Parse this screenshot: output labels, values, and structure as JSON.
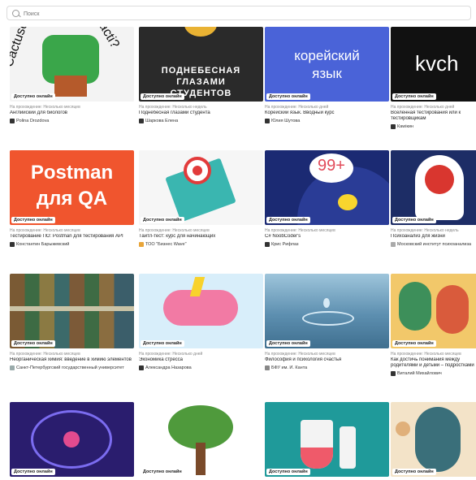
{
  "search": {
    "placeholder": "Поиск"
  },
  "cards": [
    {
      "badge": "Доступно онлайн",
      "meta": "На прохождение: Несколько месяцев",
      "title": "Английский для биологов",
      "author": "Polina Drozdova",
      "thumb_text": "Cactuse",
      "thumb_text2": "acti?",
      "bg": "#f3f3f3"
    },
    {
      "badge": "Доступно онлайн",
      "meta": "На прохождение: Несколько недель",
      "title": "Поднебесная глазами студента",
      "author": "Шаркова Елена",
      "thumb_text": "ПОДНЕБЕСНАЯ",
      "thumb_text2": "ГЛАЗАМИ",
      "thumb_text3": "СТУДЕНТОВ",
      "bg": "#2a2a2a"
    },
    {
      "badge": "Доступно онлайн",
      "meta": "На прохождение: Несколько дней",
      "title": "Корейский язык. Вводный курс",
      "author": "Юлия Шутова",
      "thumb_text": "корейский",
      "thumb_text2": "язык",
      "bg": "#4a63d8"
    },
    {
      "badge": "Доступно онлайн",
      "meta": "На прохождение: Несколько дней",
      "title": "Вселенная тестирования или к тестировщикам",
      "author": "Кawiкин",
      "thumb_text": "kvch",
      "bg": "#111111"
    },
    {
      "badge": "Доступно онлайн",
      "meta": "На прохождение: Несколько месяцев",
      "title": "Тестирование ПО: Postman для тестирования API",
      "author": "Константин Барыжевский",
      "thumb_text": "Postman",
      "thumb_text2": "для QA",
      "bg": "#f0552e"
    },
    {
      "badge": "Доступно онлайн",
      "meta": "На прохождение: Несколько месяцев",
      "title": "Тайтл-тест: курс для начинающих",
      "author": "ТОО \"Бизнес Wave\"",
      "bg": "#f6f6f6"
    },
    {
      "badge": "Доступно онлайн",
      "meta": "На прохождение: Несколько месяцев",
      "title": "C# NoobCoder's",
      "author": "Крис Рифлаз",
      "thumb_text": "99+",
      "bg": "#1b2a73"
    },
    {
      "badge": "Доступно онлайн",
      "meta": "На прохождение: Несколько недель",
      "title": "Психоанализ для жизни",
      "author": "Московский институт психоанализа",
      "bg": "#1d2d66"
    },
    {
      "badge": "Доступно онлайн",
      "meta": "На прохождение: Несколько месяцев",
      "title": "Неорганическая химия: введение в химию элементов",
      "author": "Санкт-Петербургский государственный университет",
      "bg": "#5a6a55"
    },
    {
      "badge": "Доступно онлайн",
      "meta": "На прохождение: Несколько дней",
      "title": "Экономика стресса",
      "author": "Александра Назарова",
      "bg": "#d8eefa"
    },
    {
      "badge": "Доступно онлайн",
      "meta": "На прохождение: Несколько месяцев",
      "title": "Философия и психология счастья",
      "author": "БФУ им. И. Канта",
      "bg": "#5d8fb0"
    },
    {
      "badge": "Доступно онлайн",
      "meta": "На прохождение: Несколько месяцев",
      "title": "Как достичь понимания между родителями и детьми – подростками",
      "author": "Виталий Михайлович",
      "bg": "#f2c86a"
    },
    {
      "badge": "Доступно онлайн",
      "meta": "",
      "title": "",
      "author": "",
      "bg": "#2a1d6e"
    },
    {
      "badge": "Доступно онлайн",
      "meta": "",
      "title": "",
      "author": "",
      "bg": "#ffffff"
    },
    {
      "badge": "Доступно онлайн",
      "meta": "",
      "title": "",
      "author": "",
      "bg": "#1f9a9a"
    },
    {
      "badge": "Доступно онлайн",
      "meta": "",
      "title": "",
      "author": "",
      "bg": "#f3e3c8"
    }
  ]
}
